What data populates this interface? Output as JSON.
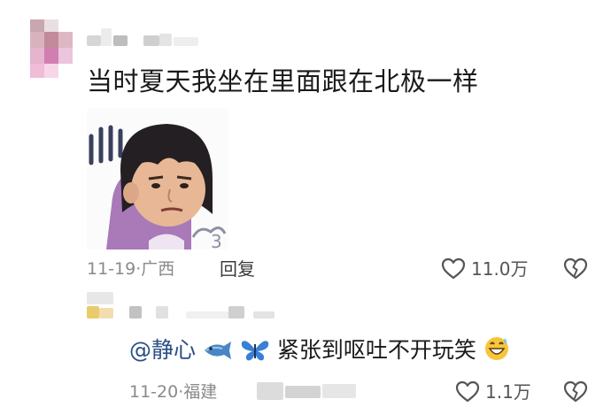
{
  "comment": {
    "text": "当时夏天我坐在里面跟在北极一样",
    "date": "11-19",
    "separator": "·",
    "location": "广西",
    "reply_label": "回复",
    "like_count": "11.0万",
    "sticker_icon": "cartoon-girl-shivering-sticker"
  },
  "reply": {
    "mention": "@静心",
    "mention_emojis": [
      "fish-emoji",
      "butterfly-emoji"
    ],
    "text": "紧张到呕吐不开玩笑",
    "trailing_emoji": "grinning-sweat-emoji",
    "date": "11-20",
    "separator": "·",
    "location": "福建",
    "like_count": "1.1万"
  },
  "icons": {
    "like": "heart-outline-icon",
    "dislike": "broken-heart-icon"
  },
  "colors": {
    "mention": "#2a4f86",
    "meta_gray": "#8a8a8a",
    "text": "#1a1a1a"
  }
}
